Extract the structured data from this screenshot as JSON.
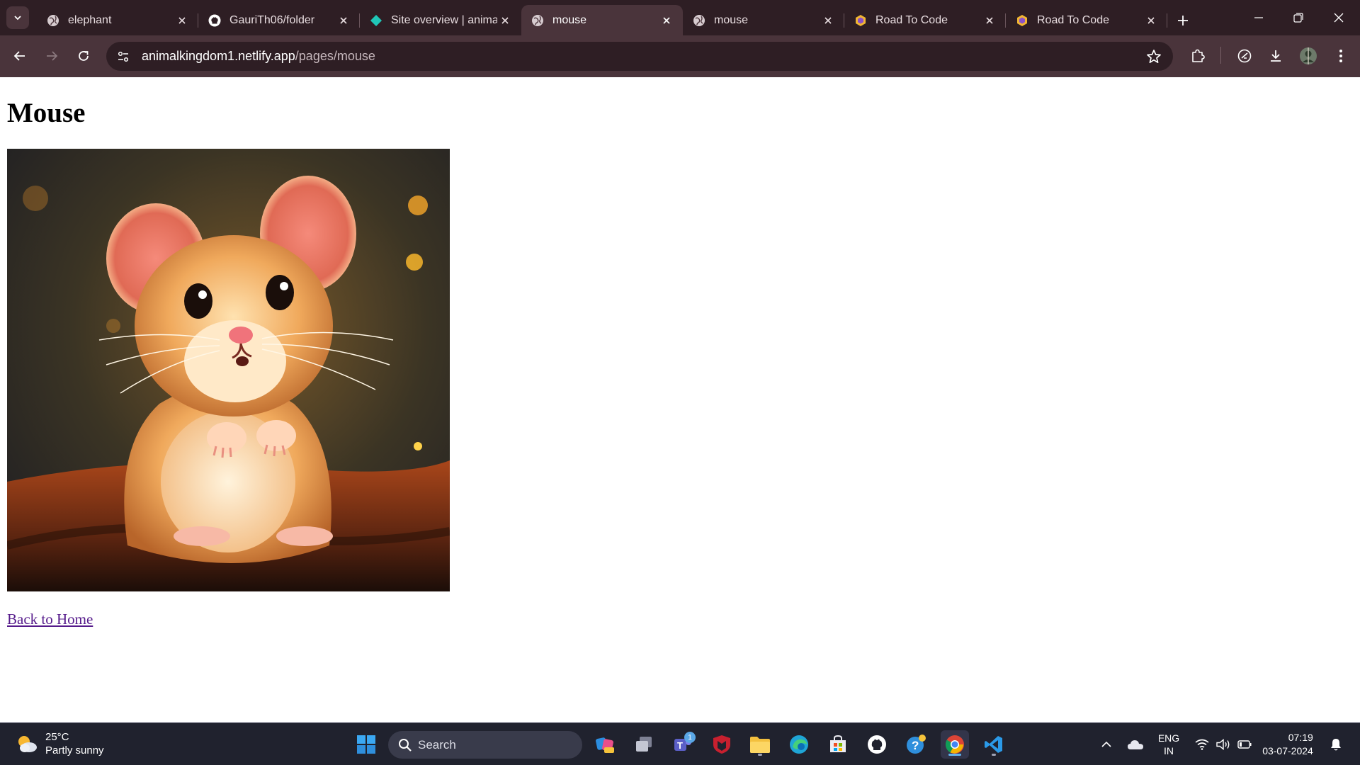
{
  "browser": {
    "tabs": [
      {
        "title": "elephant",
        "icon": "globe-icon",
        "active": false
      },
      {
        "title": "GauriTh06/folder",
        "icon": "github-icon",
        "active": false
      },
      {
        "title": "Site overview | anima",
        "icon": "netlify-icon",
        "active": false
      },
      {
        "title": "mouse",
        "icon": "globe-icon",
        "active": true
      },
      {
        "title": "mouse",
        "icon": "globe-icon",
        "active": false
      },
      {
        "title": "Road To Code",
        "icon": "hexagon-icon",
        "active": false
      },
      {
        "title": "Road To Code",
        "icon": "hexagon-icon",
        "active": false
      }
    ],
    "url_host": "animalkingdom1.netlify.app",
    "url_path": "/pages/mouse",
    "colors": {
      "frame": "#2e1e24",
      "toolbar": "#4a343b"
    }
  },
  "page": {
    "heading": "Mouse",
    "image_alt": "cute orange mouse illustration",
    "back_link": "Back to Home",
    "link_color": "#551a8b"
  },
  "taskbar": {
    "weather_temp": "25°C",
    "weather_desc": "Partly sunny",
    "search_label": "Search",
    "teams_badge": "1",
    "lang_line1": "ENG",
    "lang_line2": "IN",
    "time": "07:19",
    "date": "03-07-2024",
    "colors": {
      "bg": "#20222e",
      "accent": "#5fb3f0"
    }
  }
}
